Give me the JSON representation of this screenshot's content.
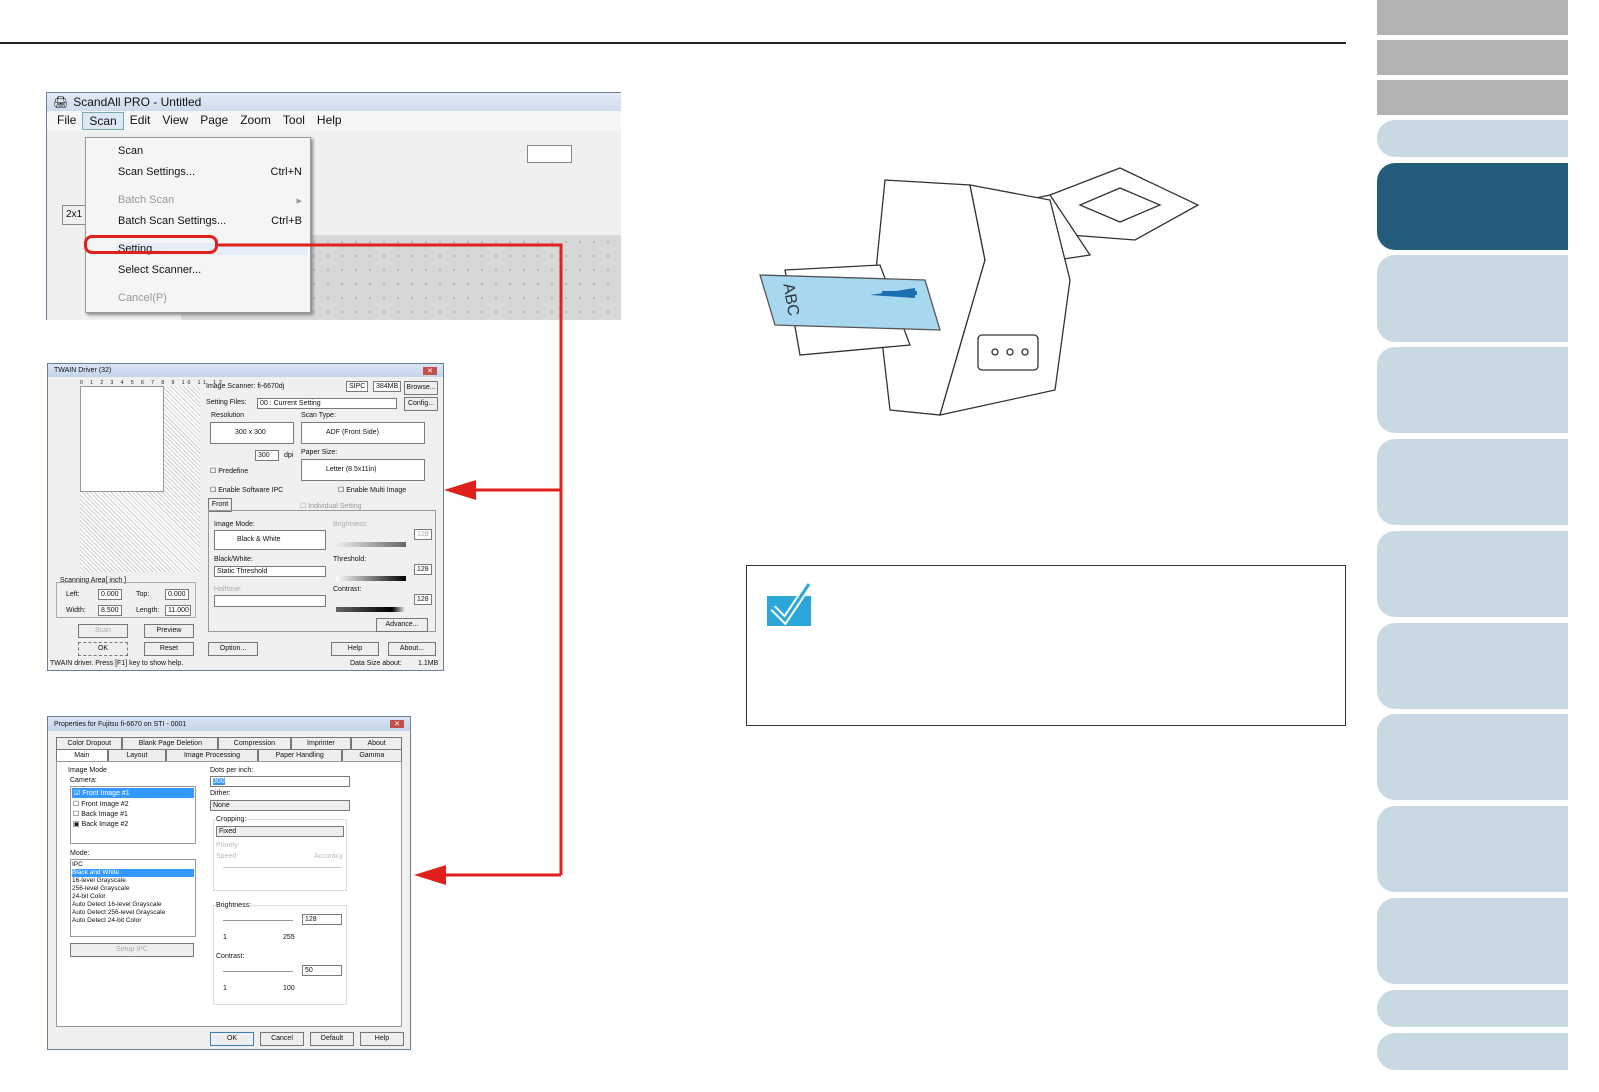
{
  "scandall": {
    "title": "ScandAll PRO - Untitled",
    "menubar": [
      "File",
      "Scan",
      "Edit",
      "View",
      "Page",
      "Zoom",
      "Tool",
      "Help"
    ],
    "menu": [
      {
        "label": "Scan",
        "shortcut": ""
      },
      {
        "label": "Scan Settings...",
        "shortcut": "Ctrl+N"
      },
      {
        "label": "Batch Scan",
        "shortcut": ""
      },
      {
        "label": "Batch Scan Settings...",
        "shortcut": "Ctrl+B"
      },
      {
        "label": "Setting...",
        "shortcut": ""
      },
      {
        "label": "Select Scanner...",
        "shortcut": ""
      },
      {
        "label": "Cancel(P)",
        "shortcut": ""
      }
    ],
    "zoom_label": "2x1"
  },
  "twain": {
    "title": "TWAIN Driver (32)",
    "scanner": "Image Scanner: fi-6670dj",
    "ipc": "SIPC",
    "mem": "384MB",
    "browse": "Browse...",
    "setting_files_label": "Setting Files:",
    "setting_file": "00 : Current Setting",
    "config": "Config...",
    "resolution_label": "Resolution",
    "resolution": "300 x 300",
    "dpi_value": "300",
    "dpi": "dpi",
    "predefine": "Predefine",
    "scan_type_label": "Scan Type:",
    "scan_type": "ADF (Front Side)",
    "paper_size_label": "Paper Size:",
    "paper_size": "Letter (8.5x11in)",
    "enable_sw_ipc": "Enable Software IPC",
    "enable_multi": "Enable Multi Image",
    "front_tab": "Front",
    "individual": "Individual Setting",
    "image_mode_label": "Image Mode:",
    "image_mode": "Black & White",
    "bw_label": "Black/White:",
    "bw": "Static Threshold",
    "halftone_label": "Halftone:",
    "brightness_label": "Brightness:",
    "brightness": "128",
    "threshold_label": "Threshold:",
    "threshold": "128",
    "contrast_label": "Contrast:",
    "contrast": "128",
    "advance": "Advance...",
    "area_label": "Scanning Area[ inch ]",
    "left_label": "Left:",
    "left": "0.000",
    "top_label": "Top:",
    "top": "0.000",
    "width_label": "Width:",
    "width": "8.500",
    "length_label": "Length:",
    "length": "11.000",
    "scan": "Scan",
    "preview": "Preview",
    "ok": "OK",
    "reset": "Reset",
    "option": "Option...",
    "help": "Help",
    "about": "About...",
    "status": "TWAIN driver. Press [F1] key to show help.",
    "data_size_label": "Data Size about:",
    "data_size": "1.1MB",
    "ruler": [
      "0",
      "1",
      "2",
      "3",
      "4",
      "5",
      "6",
      "7",
      "8",
      "9",
      "10",
      "11",
      "12"
    ]
  },
  "props": {
    "title": "Properties for Fujitsu fi-6670 on STI - 0001",
    "tabs_row1": [
      "Color Dropout",
      "Blank Page Deletion",
      "Compression",
      "Imprinter",
      "About"
    ],
    "tabs_row2": [
      "Main",
      "Layout",
      "Image Processing",
      "Paper Handling",
      "Gamma"
    ],
    "image_mode": "Image Mode",
    "camera": "Camera:",
    "cameras": [
      "Front Image #1",
      "Front Image #2",
      "Back Image #1",
      "Back Image #2"
    ],
    "mode_label": "Mode:",
    "modes": [
      "IPC",
      "Black and White",
      "16-level Grayscale",
      "256-level Grayscale",
      "24-bit Color",
      "Auto Detect 16-level Grayscale",
      "Auto Detect 256-level Grayscale",
      "Auto Detect 24-bit Color"
    ],
    "setup_ipc": "Setup IPC",
    "dpi_label": "Dots per inch:",
    "dpi": "300",
    "dither_label": "Dither:",
    "dither": "None",
    "cropping_label": "Cropping:",
    "cropping": "Fixed",
    "priority": "Priority:",
    "speed": "Speed",
    "accuracy": "Accuracy",
    "brightness_label": "Brightness:",
    "brightness": "128",
    "b_min": "1",
    "b_max": "255",
    "contrast_label": "Contrast:",
    "contrast": "50",
    "c_min": "1",
    "c_max": "100",
    "ok": "OK",
    "cancel": "Cancel",
    "default": "Default",
    "help": "Help"
  },
  "illustration": {
    "paper_text": "ABC"
  },
  "colors": {
    "highlight": "#e0201a",
    "active_tab": "#245b7a",
    "tab": "#c9d9e3",
    "check": "#2aa7d8"
  }
}
